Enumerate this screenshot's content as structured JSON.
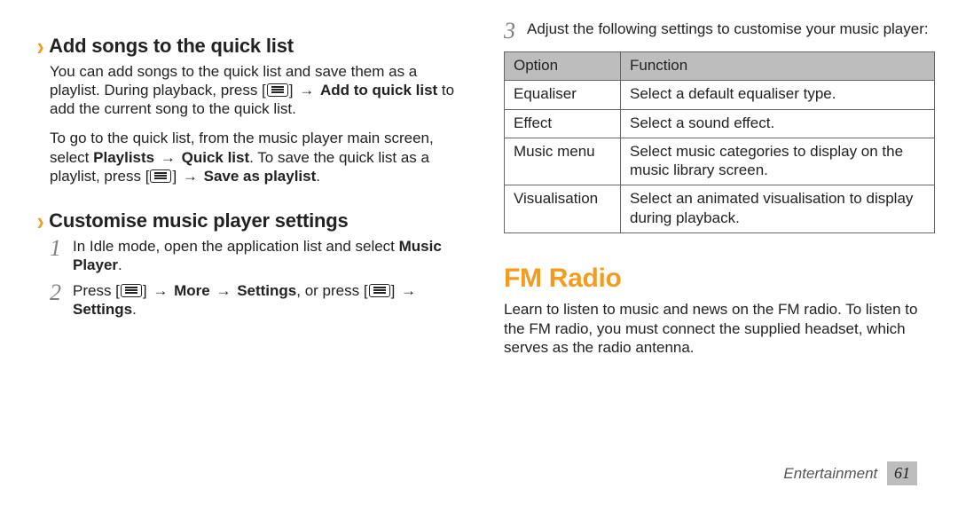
{
  "left": {
    "sec1": {
      "title": "Add songs to the quick list",
      "p1a": "You can add songs to the quick list and save them as a playlist. During playback, press [",
      "p1b_bold": "Add to quick list",
      "p1c": " to add the current song to the quick list.",
      "p2a": "To go to the quick list, from the music player main screen, select ",
      "p2b_bold": "Playlists",
      "p2c_bold": "Quick list",
      "p2d": ". To save the quick list as a playlist, press [",
      "p2e_bold": "Save as playlist",
      "p2end": "."
    },
    "sec2": {
      "title": "Customise music player settings",
      "s1a": "In Idle mode, open the application list and select ",
      "s1b_bold": "Music Player",
      "s1end": ".",
      "s2a": "Press [",
      "s2b_bold": "More",
      "s2c_bold": "Settings",
      "s2d": ", or press [",
      "s2e_bold": "Settings",
      "s2end": "."
    }
  },
  "right": {
    "step3": "Adjust the following settings to customise your music player:",
    "table": {
      "head_option": "Option",
      "head_function": "Function",
      "rows": [
        {
          "option": "Equaliser",
          "function": "Select a default equaliser type."
        },
        {
          "option": "Effect",
          "function": "Select a sound effect."
        },
        {
          "option": "Music menu",
          "function": "Select music categories to display on the music library screen."
        },
        {
          "option": "Visualisation",
          "function": "Select an animated visualisation to display during playback."
        }
      ]
    },
    "fm_head": "FM Radio",
    "fm_para": "Learn to listen to music and news on the FM radio. To listen to the FM radio, you must connect the supplied headset, which serves as the radio antenna."
  },
  "footer": {
    "section": "Entertainment",
    "page": "61"
  },
  "steps": {
    "n1": "1",
    "n2": "2",
    "n3": "3"
  },
  "arrow": "→"
}
